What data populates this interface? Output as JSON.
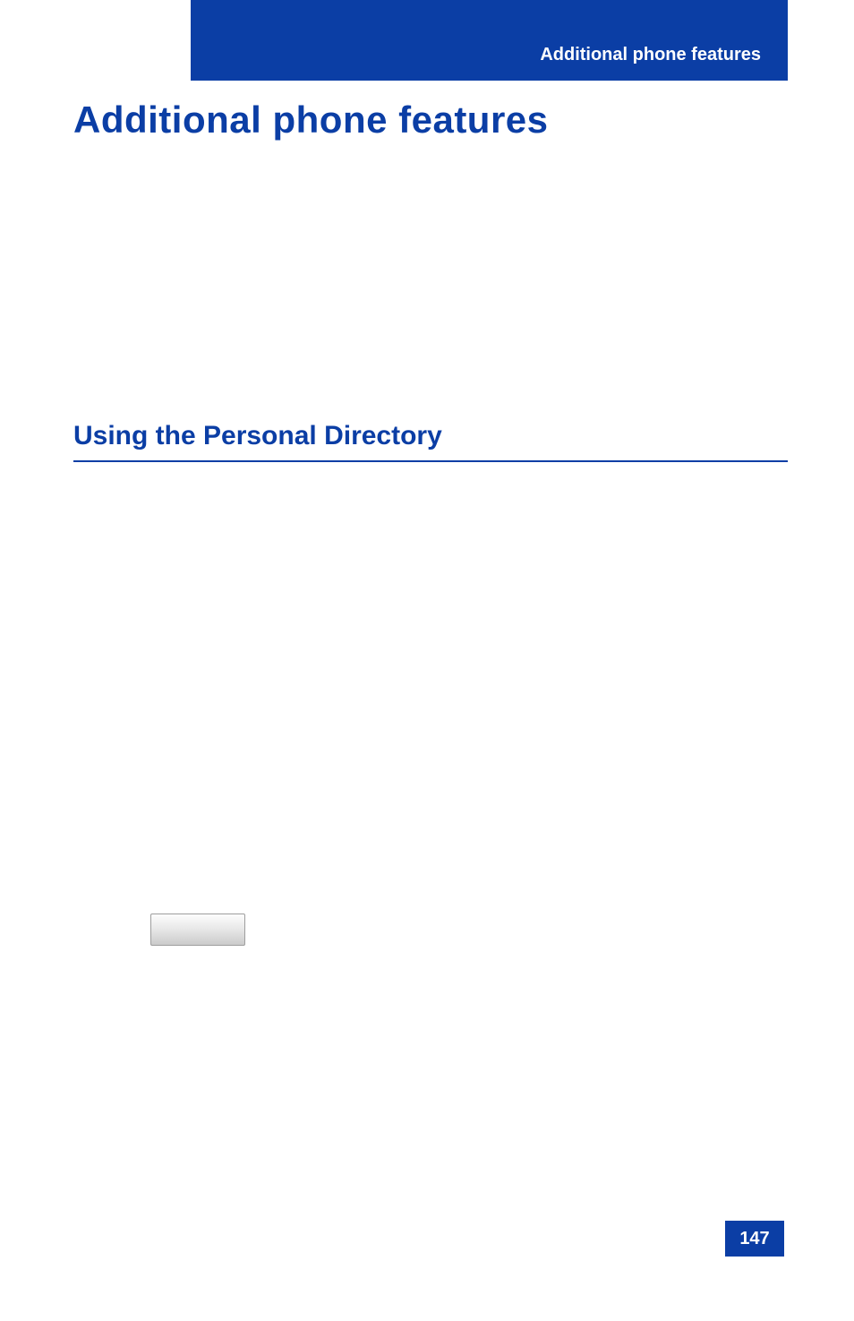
{
  "header": {
    "running_title": "Additional phone features"
  },
  "title": "Additional phone features",
  "subtitle": "Using the Personal Directory",
  "page_number": "147"
}
